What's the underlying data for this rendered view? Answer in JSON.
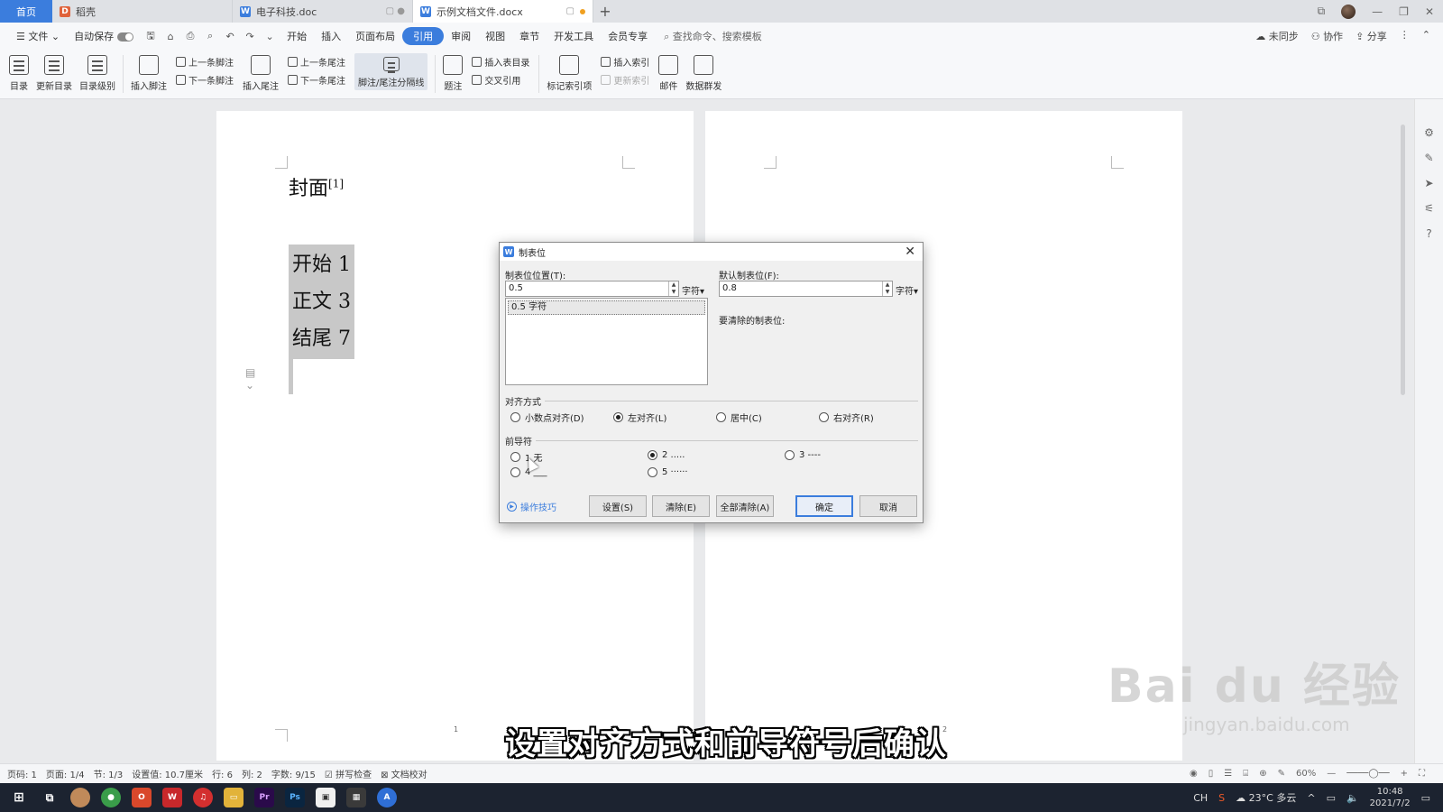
{
  "tabs": {
    "home": "首页",
    "items": [
      {
        "label": "稻壳",
        "icon": "daoke-icon",
        "color": "#e0623a",
        "active": false
      },
      {
        "label": "电子科技.doc",
        "icon": "wps-writer-icon",
        "color": "#3b7ddd",
        "active": false
      },
      {
        "label": "示例文档文件.docx",
        "icon": "wps-writer-icon",
        "color": "#3b7ddd",
        "active": true
      }
    ],
    "add": "+"
  },
  "menubar": {
    "file": "文件",
    "autosave": "自动保存",
    "items": [
      "开始",
      "插入",
      "页面布局",
      "引用",
      "审阅",
      "视图",
      "章节",
      "开发工具",
      "会员专享"
    ],
    "active": "引用",
    "search": "查找命令、搜索模板",
    "right": [
      "未同步",
      "协作",
      "分享"
    ]
  },
  "ribbon": {
    "toc": "目录",
    "update_toc": "更新目录",
    "toc_level": "目录级别",
    "insert_footnote": "插入脚注",
    "prev_footnote": "上一条脚注",
    "next_footnote": "下一条脚注",
    "insert_endnote": "插入尾注",
    "prev_endnote": "上一条尾注",
    "next_endnote": "下一条尾注",
    "separator": "脚注/尾注分隔线",
    "caption": "题注",
    "insert_table_of_figures": "插入表目录",
    "cross_ref": "交叉引用",
    "mark_entry": "标记索引项",
    "insert_index": "插入索引",
    "update_index": "更新索引",
    "mail": "邮件",
    "data_send": "数据群发"
  },
  "document": {
    "title": "封面",
    "title_sup": "[1]",
    "toc_lines": [
      "开始 1",
      "正文 3",
      "结尾 7"
    ],
    "page1_no": "1",
    "page2_no": "2"
  },
  "dialog": {
    "title": "制表位",
    "tab_pos_label": "制表位位置(T):",
    "tab_pos_value": "0.5",
    "unit": "字符",
    "default_tab_label": "默认制表位(F):",
    "default_tab_value": "0.8",
    "list_items": [
      "0.5 字符"
    ],
    "clear_label": "要清除的制表位:",
    "align_title": "对齐方式",
    "align_options": [
      "小数点对齐(D)",
      "左对齐(L)",
      "居中(C)",
      "右对齐(R)"
    ],
    "align_selected": 1,
    "leader_title": "前导符",
    "leader_options": [
      "1 无",
      "2 .....",
      "3 ----",
      "4 ___",
      "5 ······"
    ],
    "leader_selected": 1,
    "tips": "操作技巧",
    "btn_set": "设置(S)",
    "btn_clear": "清除(E)",
    "btn_clear_all": "全部清除(A)",
    "btn_ok": "确定",
    "btn_cancel": "取消"
  },
  "statusbar": {
    "page": "页码: 1",
    "pages": "页面: 1/4",
    "section": "节: 1/3",
    "setting": "设置值: 10.7厘米",
    "row": "行: 6",
    "col": "列: 2",
    "words": "字数: 9/15",
    "spell": "拼写检查",
    "proof": "文档校对",
    "zoom": "60%"
  },
  "taskbar": {
    "apps": [
      {
        "icon": "windows-start-icon",
        "color": "#1c2330"
      },
      {
        "icon": "task-view-icon",
        "color": "#1c2330"
      },
      {
        "icon": "avatar-app-icon",
        "color": "#c08a5a"
      },
      {
        "icon": "chrome-icon",
        "color": "#3a9d4a"
      },
      {
        "icon": "office-icon",
        "color": "#d9482b"
      },
      {
        "icon": "wps-icon",
        "color": "#c8282b"
      },
      {
        "icon": "netease-music-icon",
        "color": "#d32f2f"
      },
      {
        "icon": "file-explorer-icon",
        "color": "#e2b33a"
      },
      {
        "icon": "premiere-icon",
        "color": "#2a0a4a"
      },
      {
        "icon": "photoshop-icon",
        "color": "#0a2540"
      },
      {
        "icon": "whiteboard-icon",
        "color": "#f0f0f0"
      },
      {
        "icon": "calculator-icon",
        "color": "#3a3a3a"
      },
      {
        "icon": "arc-icon",
        "color": "#2f6fd6"
      }
    ],
    "ime": "CH",
    "weather": "23°C 多云",
    "time": "10:48",
    "date": "2021/7/2"
  },
  "subtitle": "设置对齐方式和前导符号后确认",
  "watermark": {
    "big": "Bai du 经验",
    "small": "jingyan.baidu.com"
  }
}
